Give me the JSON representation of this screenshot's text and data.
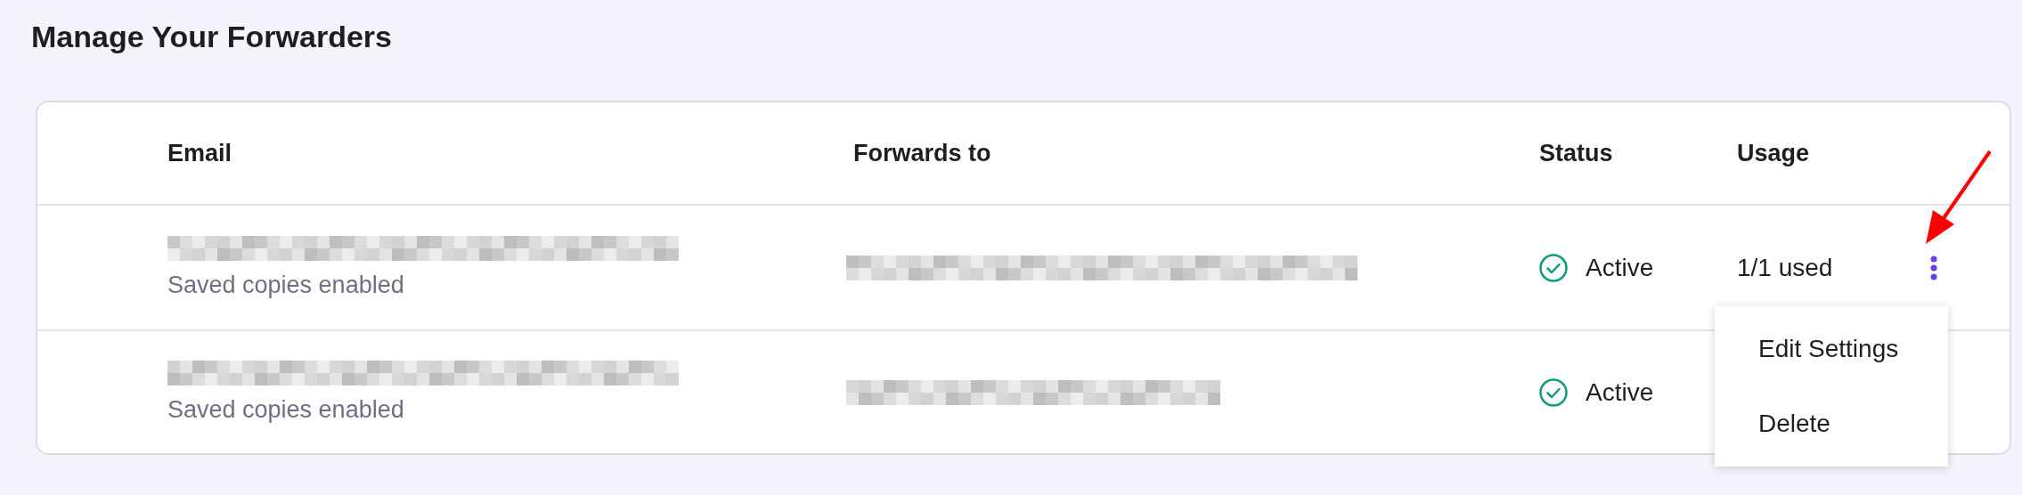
{
  "page": {
    "title": "Manage Your Forwarders"
  },
  "table": {
    "columns": [
      "Email",
      "Forwards to",
      "Status",
      "Usage"
    ],
    "rows": [
      {
        "email": {
          "redacted": true
        },
        "note": "Saved copies enabled",
        "forwards_to": {
          "redacted": true
        },
        "status": {
          "kind": "active",
          "label": "Active"
        },
        "usage": "1/1 used",
        "menu_button": true
      },
      {
        "email": {
          "redacted": true
        },
        "note": "Saved copies enabled",
        "forwards_to": {
          "redacted": true
        },
        "status": {
          "kind": "active",
          "label": "Active"
        },
        "menu_button": false
      }
    ]
  },
  "menu": {
    "items": [
      "Edit Settings",
      "Delete"
    ]
  },
  "annotation": {
    "kind": "arrow"
  }
}
